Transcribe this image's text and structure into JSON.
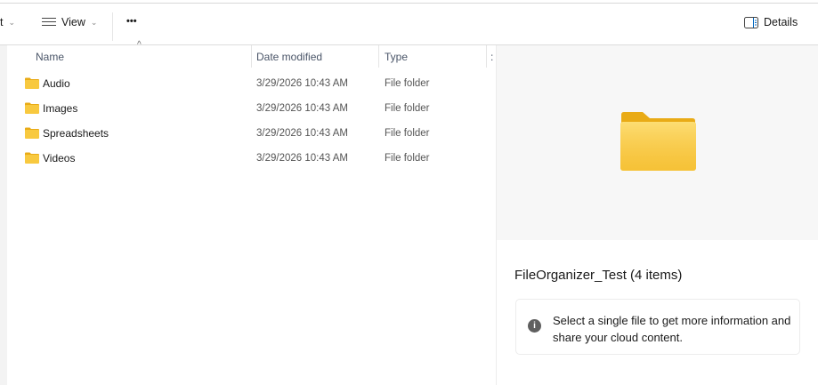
{
  "toolbar": {
    "sort_label_partial": "t",
    "view_label": "View",
    "more_label": "•••",
    "details_label": "Details"
  },
  "columns": {
    "name": "Name",
    "date": "Date modified",
    "type": "Type",
    "extra": ":"
  },
  "files": [
    {
      "name": "Audio",
      "date": "3/29/2026 10:43 AM",
      "type": "File folder"
    },
    {
      "name": "Images",
      "date": "3/29/2026 10:43 AM",
      "type": "File folder"
    },
    {
      "name": "Spreadsheets",
      "date": "3/29/2026 10:43 AM",
      "type": "File folder"
    },
    {
      "name": "Videos",
      "date": "3/29/2026 10:43 AM",
      "type": "File folder"
    }
  ],
  "details": {
    "title": "FileOrganizer_Test (4 items)",
    "info": "Select a single file to get more information and share your cloud content.",
    "info_icon": "i"
  },
  "colors": {
    "folder": "#f8c93f",
    "folder_dark": "#e9ab16",
    "accent": "#0067c0"
  }
}
